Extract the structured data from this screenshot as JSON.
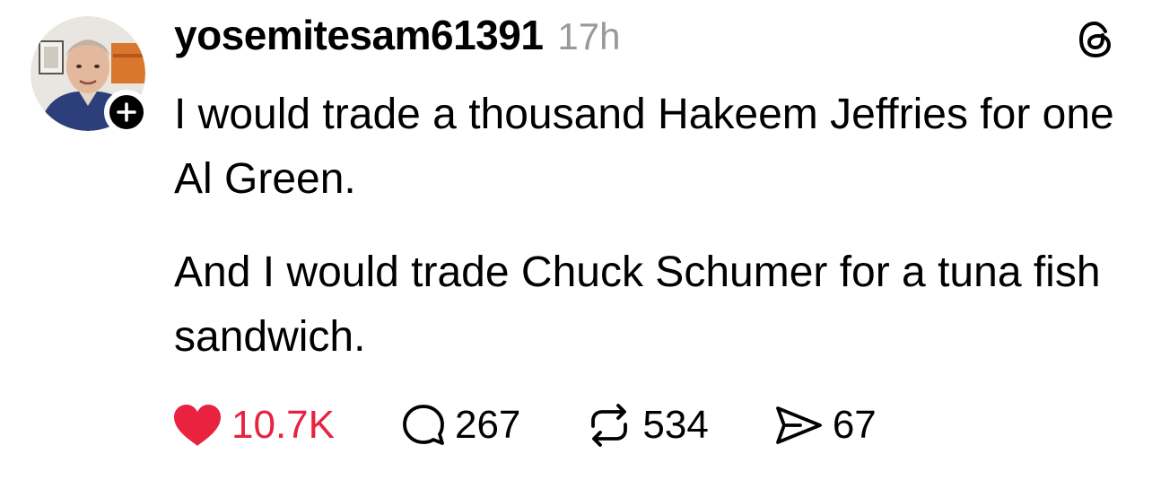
{
  "post": {
    "username": "yosemitesam61391",
    "timestamp": "17h",
    "paragraphs": [
      "I would trade a thousand Hakeem Jeffries for one Al Green.",
      "And I would trade Chuck Schumer for a tuna fish sandwich."
    ],
    "actions": {
      "likes": "10.7K",
      "replies": "267",
      "reposts": "534",
      "shares": "67"
    },
    "liked": true
  },
  "icons": {
    "avatar": "avatar",
    "follow": "plus-icon",
    "app": "threads-logo-icon",
    "like": "heart-icon",
    "reply": "comment-icon",
    "repost": "repost-icon",
    "share": "send-icon"
  },
  "colors": {
    "like": "#e8223f",
    "timestamp": "#999999",
    "text": "#000000"
  }
}
